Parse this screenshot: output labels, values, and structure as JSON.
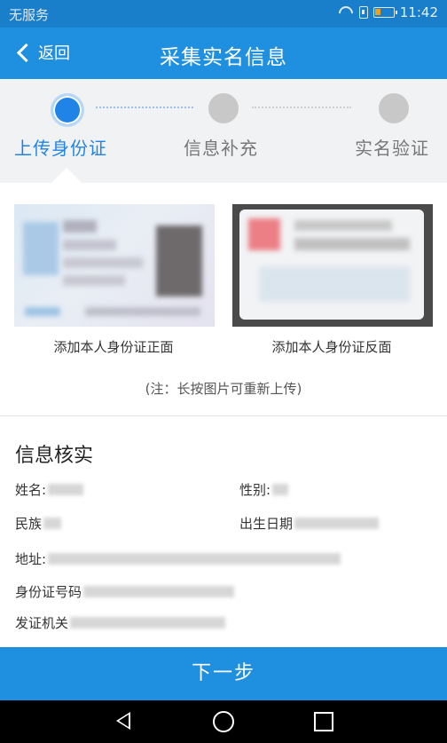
{
  "status_bar": {
    "carrier": "无服务",
    "time": "11:42"
  },
  "nav": {
    "back_label": "返回",
    "title": "采集实名信息"
  },
  "steps": [
    {
      "label": "上传身份证",
      "state": "active"
    },
    {
      "label": "信息补充",
      "state": "inactive"
    },
    {
      "label": "实名验证",
      "state": "inactive"
    }
  ],
  "upload": {
    "front_caption": "添加本人身份证正面",
    "back_caption": "添加本人身份证反面",
    "note": "(注：长按图片可重新上传)"
  },
  "info": {
    "title": "信息核实",
    "name_label": "姓名:",
    "gender_label": "性别:",
    "ethnicity_label": "民族",
    "birthdate_label": "出生日期",
    "address_label": "地址:",
    "id_number_label": "身份证号码",
    "authority_label": "发证机关"
  },
  "next_button": "下一步",
  "colors": {
    "primary": "#1f8fe0",
    "status_bar": "#1a7fcb",
    "step_active": "#1f84e6"
  }
}
